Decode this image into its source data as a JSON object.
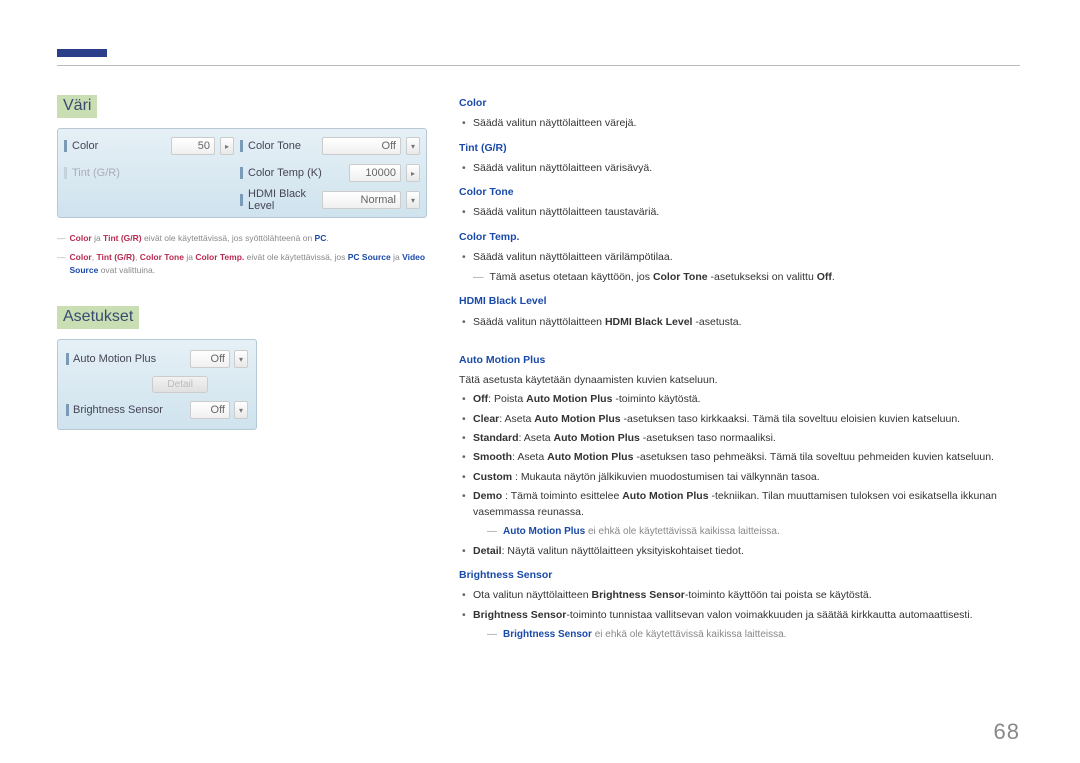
{
  "page_number": "68",
  "left": {
    "section1_title": "Väri",
    "panel1": {
      "color_label": "Color",
      "color_value": "50",
      "tint_label": "Tint (G/R)",
      "ct_label": "Color Tone",
      "ct_value": "Off",
      "ctk_label": "Color Temp (K)",
      "ctk_value": "10000",
      "hbl_label": "HDMI Black Level",
      "hbl_value": "Normal"
    },
    "fn1_pre": "Color",
    "fn1_mid": " ja ",
    "fn1_b": "Tint (G/R)",
    "fn1_post": " eivät ole käytettävissä, jos syöttölähteenä on ",
    "fn1_pc": "PC",
    "fn1_end": ".",
    "fn2_a": "Color",
    "fn2_b": "Tint (G/R)",
    "fn2_c": "Color Tone",
    "fn2_d": "Color Temp.",
    "fn2_sep1": ", ",
    "fn2_sep2": " ja ",
    "fn2_post": " eivät ole käytettävissä, jos ",
    "fn2_e": "PC Source",
    "fn2_sep3": " ja ",
    "fn2_f": "Video Source",
    "fn2_end": " ovat valittuina.",
    "section2_title": "Asetukset",
    "panel2": {
      "amp_label": "Auto Motion Plus",
      "amp_value": "Off",
      "detail_btn": "Detail",
      "bs_label": "Brightness Sensor",
      "bs_value": "Off"
    }
  },
  "right": {
    "color_h": "Color",
    "color_desc": "Säädä valitun näyttölaitteen värejä.",
    "tint_h": "Tint (G/R)",
    "tint_desc": "Säädä valitun näyttölaitteen värisävyä.",
    "ct_h": "Color Tone",
    "ct_desc": "Säädä valitun näyttölaitteen taustaväriä.",
    "ctemp_h": "Color Temp.",
    "ctemp_desc": "Säädä valitun näyttölaitteen värilämpötilaa.",
    "ctemp_note_pre": "Tämä asetus otetaan käyttöön, jos ",
    "ctemp_note_b": "Color Tone",
    "ctemp_note_mid": " -asetukseksi on valittu ",
    "ctemp_note_off": "Off",
    "ctemp_note_end": ".",
    "hbl_h": "HDMI Black Level",
    "hbl_desc_pre": "Säädä valitun näyttölaitteen ",
    "hbl_desc_b": "HDMI Black Level",
    "hbl_desc_post": " -asetusta.",
    "amp_h": "Auto Motion Plus",
    "amp_intro": "Tätä asetusta käytetään dynaamisten kuvien katseluun.",
    "amp_off_b": "Off",
    "amp_off_mid": ": Poista ",
    "amp_off_amp": "Auto Motion Plus",
    "amp_off_post": " -toiminto käytöstä.",
    "amp_clear_b": "Clear",
    "amp_clear_mid": ": Aseta ",
    "amp_clear_amp": "Auto Motion Plus",
    "amp_clear_post": " -asetuksen taso kirkkaaksi. Tämä tila soveltuu eloisien kuvien katseluun.",
    "amp_std_b": "Standard",
    "amp_std_mid": ": Aseta ",
    "amp_std_amp": "Auto Motion Plus",
    "amp_std_post": " -asetuksen taso normaaliksi.",
    "amp_smooth_b": "Smooth",
    "amp_smooth_mid": ": Aseta ",
    "amp_smooth_amp": "Auto Motion Plus",
    "amp_smooth_post": " -asetuksen taso pehmeäksi. Tämä tila soveltuu pehmeiden kuvien katseluun.",
    "amp_custom_b": "Custom",
    "amp_custom_post": " : Mukauta näytön jälkikuvien muodostumisen tai välkynnän tasoa.",
    "amp_demo_b": "Demo",
    "amp_demo_mid": " : Tämä toiminto esittelee ",
    "amp_demo_amp": "Auto Motion Plus",
    "amp_demo_post": " -tekniikan. Tilan muuttamisen tuloksen voi esikatsella ikkunan vasemmassa reunassa.",
    "amp_note_b": "Auto Motion Plus",
    "amp_note_post": " ei ehkä ole käytettävissä kaikissa laitteissa.",
    "amp_detail_b": "Detail",
    "amp_detail_post": ": Näytä valitun näyttölaitteen yksityiskohtaiset tiedot.",
    "bs_h": "Brightness Sensor",
    "bs_li1_pre": "Ota valitun näyttölaitteen ",
    "bs_li1_b": "Brightness Sensor",
    "bs_li1_post": "-toiminto käyttöön tai poista se käytöstä.",
    "bs_li2_b": "Brightness Sensor",
    "bs_li2_post": "-toiminto tunnistaa vallitsevan valon voimakkuuden ja säätää kirkkautta automaattisesti.",
    "bs_note_b": "Brightness Sensor",
    "bs_note_post": " ei ehkä ole käytettävissä kaikissa laitteissa."
  }
}
